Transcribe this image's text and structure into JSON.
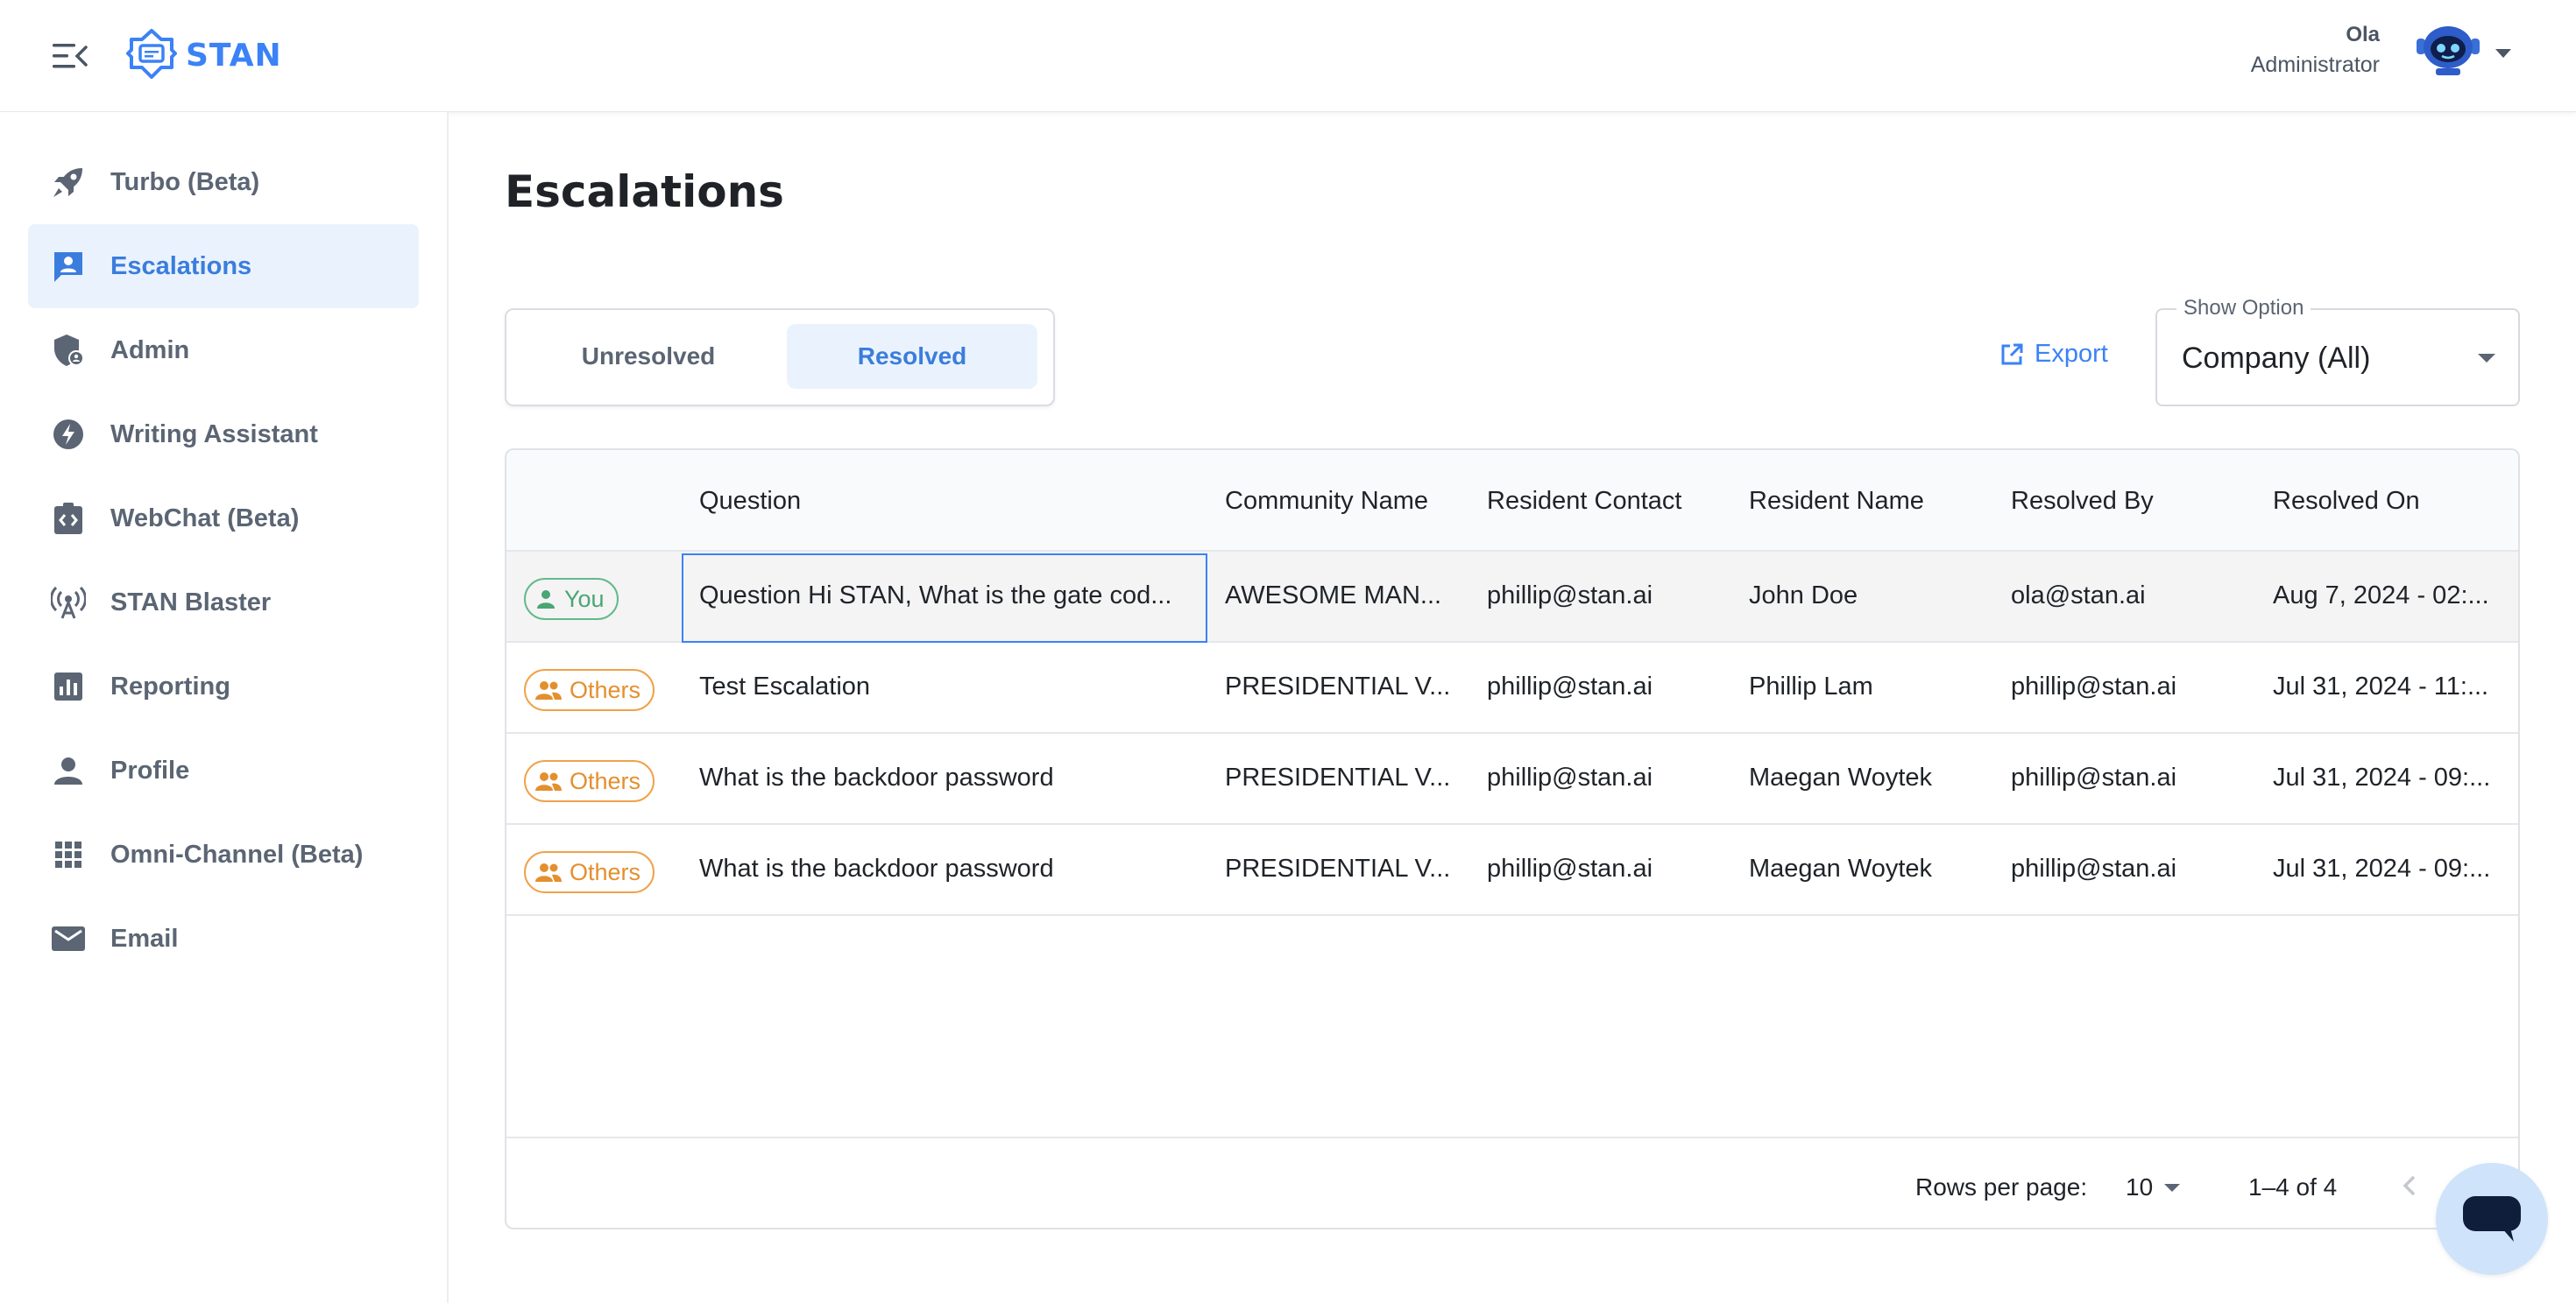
{
  "brand": {
    "name": "STAN",
    "accent": "#3b82f6"
  },
  "user": {
    "name": "Ola",
    "role": "Administrator"
  },
  "sidebar": {
    "items": [
      {
        "label": "Turbo (Beta)",
        "icon": "rocket-icon"
      },
      {
        "label": "Escalations",
        "icon": "escalation-icon",
        "active": true
      },
      {
        "label": "Admin",
        "icon": "admin-shield-icon"
      },
      {
        "label": "Writing Assistant",
        "icon": "bolt-icon"
      },
      {
        "label": "WebChat (Beta)",
        "icon": "code-clipboard-icon"
      },
      {
        "label": "STAN Blaster",
        "icon": "broadcast-icon"
      },
      {
        "label": "Reporting",
        "icon": "bar-chart-icon"
      },
      {
        "label": "Profile",
        "icon": "person-icon"
      },
      {
        "label": "Omni-Channel (Beta)",
        "icon": "grid-icon"
      },
      {
        "label": "Email",
        "icon": "mail-icon"
      }
    ]
  },
  "page": {
    "title": "Escalations"
  },
  "tabs": {
    "unresolved": "Unresolved",
    "resolved": "Resolved",
    "selected": "Resolved"
  },
  "export": {
    "label": "Export"
  },
  "show_option": {
    "legend": "Show Option",
    "value": "Company (All)"
  },
  "table": {
    "columns": [
      "Question",
      "Community Name",
      "Resident Contact",
      "Resident Name",
      "Resolved By",
      "Resolved On"
    ],
    "rows": [
      {
        "owner": "You",
        "question": "Question Hi STAN, What is the gate cod...",
        "community": "AWESOME MAN...",
        "contact": "phillip@stan.ai",
        "resident": "John Doe",
        "resolved_by": "ola@stan.ai",
        "resolved_on": "Aug 7, 2024 - 02:..."
      },
      {
        "owner": "Others",
        "question": "Test Escalation",
        "community": "PRESIDENTIAL V...",
        "contact": "phillip@stan.ai",
        "resident": "Phillip Lam",
        "resolved_by": "phillip@stan.ai",
        "resolved_on": "Jul 31, 2024 - 11:..."
      },
      {
        "owner": "Others",
        "question": "What is the backdoor password",
        "community": "PRESIDENTIAL V...",
        "contact": "phillip@stan.ai",
        "resident": "Maegan Woytek",
        "resolved_by": "phillip@stan.ai",
        "resolved_on": "Jul 31, 2024 - 09:..."
      },
      {
        "owner": "Others",
        "question": "What is the backdoor password",
        "community": "PRESIDENTIAL V...",
        "contact": "phillip@stan.ai",
        "resident": "Maegan Woytek",
        "resolved_by": "phillip@stan.ai",
        "resolved_on": "Jul 31, 2024 - 09:..."
      }
    ]
  },
  "pagination": {
    "rows_per_page_label": "Rows per page:",
    "rows_per_page": "10",
    "range": "1–4 of 4"
  }
}
